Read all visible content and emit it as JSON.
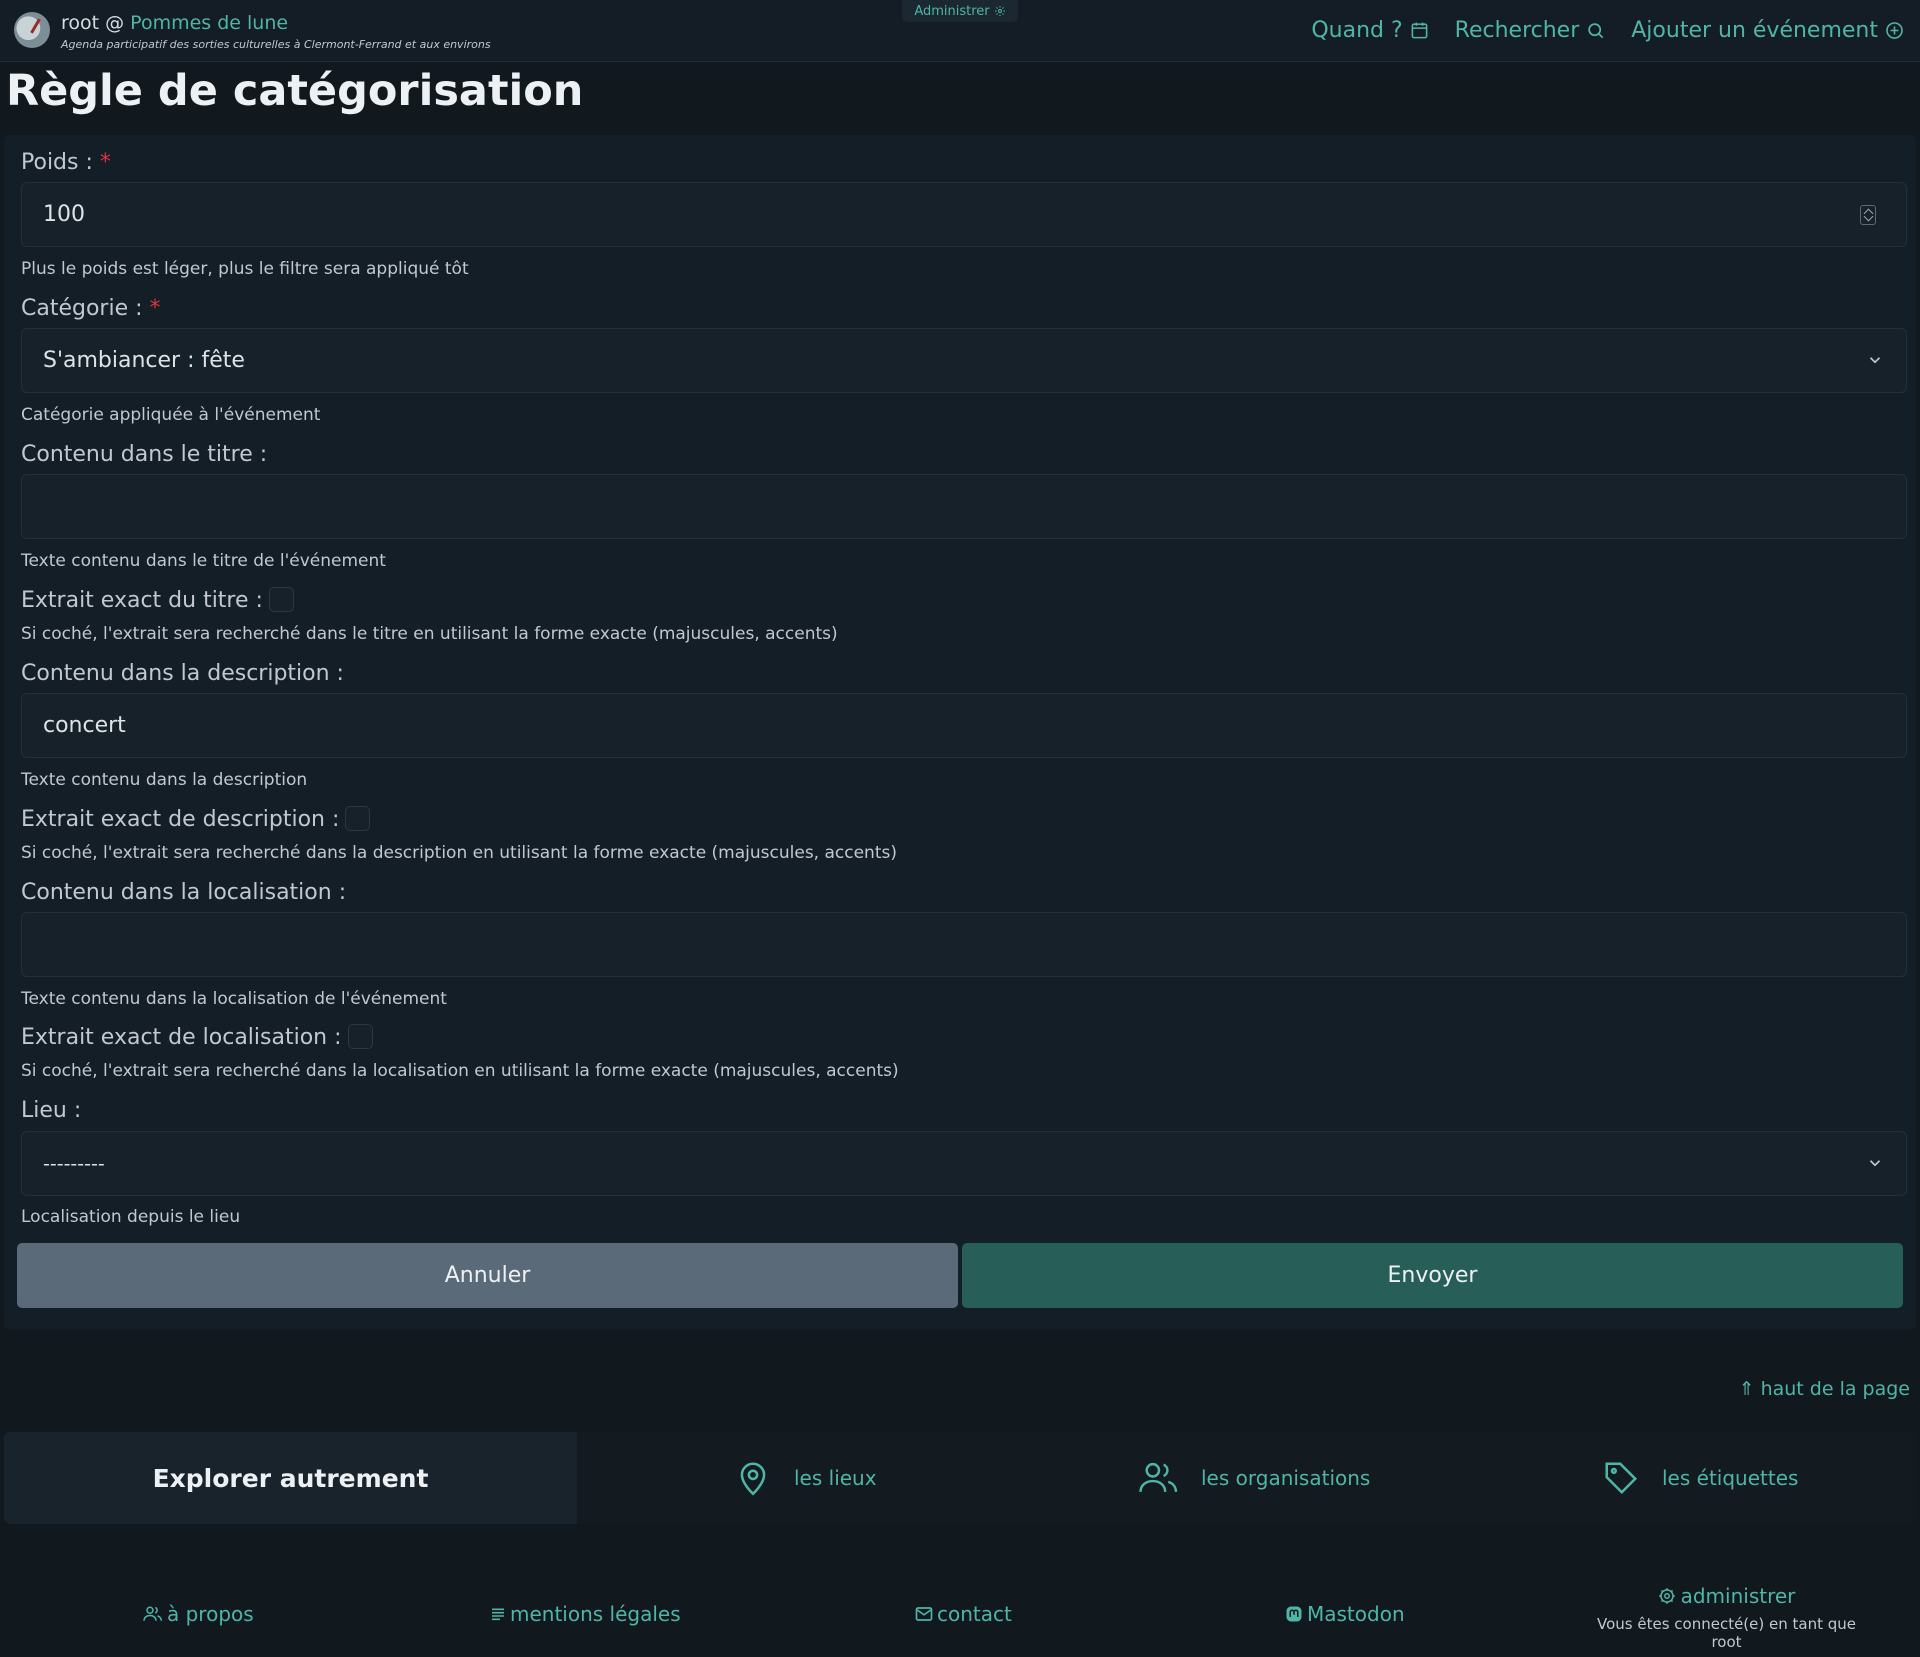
{
  "header": {
    "user": "root @ ",
    "site_name": "Pommes de lune",
    "tagline": "Agenda participatif des sorties culturelles à Clermont-Ferrand et aux environs",
    "admin_tab": "Administrer",
    "nav": {
      "when": "Quand ?",
      "search": "Rechercher",
      "add_event": "Ajouter un événement"
    }
  },
  "page_title": "Règle de catégorisation",
  "form": {
    "required_mark": "*",
    "weight": {
      "label": "Poids :",
      "value": "100",
      "help": "Plus le poids est léger, plus le filtre sera appliqué tôt"
    },
    "category": {
      "label": "Catégorie :",
      "value": "S'ambiancer : fête",
      "help": "Catégorie appliquée à l'événement"
    },
    "title_content": {
      "label": "Contenu dans le titre :",
      "value": "",
      "help": "Texte contenu dans le titre de l'événement"
    },
    "title_exact": {
      "label": "Extrait exact du titre :",
      "checked": false,
      "help": "Si coché, l'extrait sera recherché dans le titre en utilisant la forme exacte (majuscules, accents)"
    },
    "desc_content": {
      "label": "Contenu dans la description :",
      "value": "concert",
      "help": "Texte contenu dans la description"
    },
    "desc_exact": {
      "label": "Extrait exact de description :",
      "checked": false,
      "help": "Si coché, l'extrait sera recherché dans la description en utilisant la forme exacte (majuscules, accents)"
    },
    "loc_content": {
      "label": "Contenu dans la localisation :",
      "value": "",
      "help": "Texte contenu dans la localisation de l'événement"
    },
    "loc_exact": {
      "label": "Extrait exact de localisation :",
      "checked": false,
      "help": "Si coché, l'extrait sera recherché dans la localisation en utilisant la forme exacte (majuscules, accents)"
    },
    "place": {
      "label": "Lieu :",
      "value": "---------",
      "help": "Localisation depuis le lieu"
    },
    "cancel": "Annuler",
    "submit": "Envoyer"
  },
  "back_to_top": "⇑ haut de la page",
  "explore": {
    "title": "Explorer autrement",
    "places": "les lieux",
    "organisations": "les organisations",
    "tags": "les étiquettes"
  },
  "footer": {
    "about": "à propos",
    "legal": "mentions légales",
    "contact": "contact",
    "mastodon": "Mastodon",
    "admin": "administrer",
    "logged_in": "Vous êtes connecté(e) en tant que root"
  },
  "colors": {
    "accent": "#4fb5a6",
    "background": "#11191f",
    "cancel_button": "#5a6a78",
    "submit_button": "#275f58",
    "required": "#d9343d"
  }
}
